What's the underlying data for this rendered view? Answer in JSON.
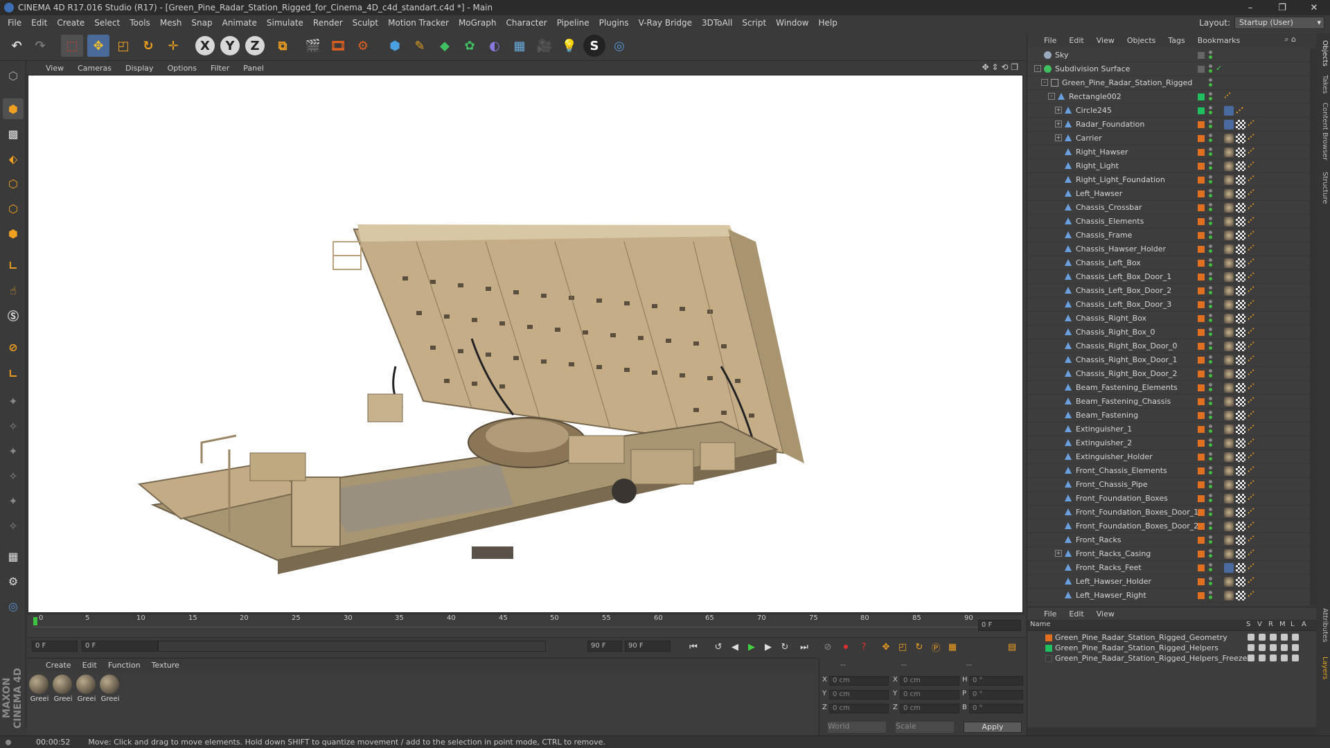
{
  "window": {
    "title": "CINEMA 4D R17.016 Studio (R17) - [Green_Pine_Radar_Station_Rigged_for_Cinema_4D_c4d_standart.c4d *] - Main",
    "controls": [
      "–",
      "❐",
      "✕"
    ]
  },
  "menu": [
    "File",
    "Edit",
    "Create",
    "Select",
    "Tools",
    "Mesh",
    "Snap",
    "Animate",
    "Simulate",
    "Render",
    "Sculpt",
    "Motion Tracker",
    "MoGraph",
    "Character",
    "Pipeline",
    "Plugins",
    "V-Ray Bridge",
    "3DToAll",
    "Script",
    "Window",
    "Help"
  ],
  "layout": {
    "label": "Layout:",
    "value": "Startup (User)"
  },
  "toolbar": {
    "axis_x": "X",
    "axis_y": "Y",
    "axis_z": "Z"
  },
  "viewport_menu": [
    "View",
    "Cameras",
    "Display",
    "Options",
    "Filter",
    "Panel"
  ],
  "timeline": {
    "ticks": [
      "0",
      "5",
      "10",
      "15",
      "20",
      "25",
      "30",
      "35",
      "40",
      "45",
      "50",
      "55",
      "60",
      "65",
      "70",
      "75",
      "80",
      "85",
      "90"
    ],
    "current_frame": "0 F"
  },
  "transport": {
    "start_field": "0 F",
    "range_start": "0 F",
    "range_end": "90 F",
    "end_field": "90 F"
  },
  "material_menu": [
    "Create",
    "Edit",
    "Function",
    "Texture"
  ],
  "materials": [
    "Greei",
    "Greei",
    "Greei",
    "Greei"
  ],
  "coordinates": {
    "header_dashes": [
      "--",
      "--",
      "--"
    ],
    "rows": [
      {
        "a1": "X",
        "v1": "0 cm",
        "a2": "X",
        "v2": "0 cm",
        "a3": "H",
        "v3": "0 °"
      },
      {
        "a1": "Y",
        "v1": "0 cm",
        "a2": "Y",
        "v2": "0 cm",
        "a3": "P",
        "v3": "0 °"
      },
      {
        "a1": "Z",
        "v1": "0 cm",
        "a2": "Z",
        "v2": "0 cm",
        "a3": "B",
        "v3": "0 °"
      }
    ],
    "mode": "World",
    "scale": "Scale",
    "apply": "Apply"
  },
  "status": {
    "time": "00:00:52",
    "message": "Move: Click and drag to move elements. Hold down SHIFT to quantize movement / add to the selection in point mode, CTRL to remove."
  },
  "maxon": "MAXON CINEMA 4D",
  "object_manager": {
    "menu": [
      "File",
      "Edit",
      "View",
      "Objects",
      "Tags",
      "Bookmarks"
    ],
    "objects": [
      {
        "name": "Sky"
      },
      {
        "name": "Subdivision Surface"
      },
      {
        "name": "Green_Pine_Radar_Station_Rigged"
      },
      {
        "name": "Rectangle002"
      },
      {
        "name": "Circle245"
      },
      {
        "name": "Radar_Foundation"
      },
      {
        "name": "Carrier"
      },
      {
        "name": "Right_Hawser"
      },
      {
        "name": "Right_Light"
      },
      {
        "name": "Right_Light_Foundation"
      },
      {
        "name": "Left_Hawser"
      },
      {
        "name": "Chassis_Crossbar"
      },
      {
        "name": "Chassis_Elements"
      },
      {
        "name": "Chassis_Frame"
      },
      {
        "name": "Chassis_Hawser_Holder"
      },
      {
        "name": "Chassis_Left_Box"
      },
      {
        "name": "Chassis_Left_Box_Door_1"
      },
      {
        "name": "Chassis_Left_Box_Door_2"
      },
      {
        "name": "Chassis_Left_Box_Door_3"
      },
      {
        "name": "Chassis_Right_Box"
      },
      {
        "name": "Chassis_Right_Box_0"
      },
      {
        "name": "Chassis_Right_Box_Door_0"
      },
      {
        "name": "Chassis_Right_Box_Door_1"
      },
      {
        "name": "Chassis_Right_Box_Door_2"
      },
      {
        "name": "Beam_Fastening_Elements"
      },
      {
        "name": "Beam_Fastening_Chassis"
      },
      {
        "name": "Beam_Fastening"
      },
      {
        "name": "Extinguisher_1"
      },
      {
        "name": "Extinguisher_2"
      },
      {
        "name": "Extinguisher_Holder"
      },
      {
        "name": "Front_Chassis_Elements"
      },
      {
        "name": "Front_Chassis_Pipe"
      },
      {
        "name": "Front_Foundation_Boxes"
      },
      {
        "name": "Front_Foundation_Boxes_Door_1"
      },
      {
        "name": "Front_Foundation_Boxes_Door_2"
      },
      {
        "name": "Front_Racks"
      },
      {
        "name": "Front_Racks_Casing"
      },
      {
        "name": "Front_Racks_Feet"
      },
      {
        "name": "Left_Hawser_Holder"
      },
      {
        "name": "Left_Hawser_Right"
      }
    ]
  },
  "side_tabs": [
    "Objects",
    "Takes",
    "Content Browser",
    "Structure",
    "Attributes",
    "Layers"
  ],
  "layer_manager": {
    "menu": [
      "File",
      "Edit",
      "View"
    ],
    "headers": [
      "Name",
      "S",
      "V",
      "R",
      "M",
      "L",
      "A"
    ],
    "layers": [
      {
        "name": "Green_Pine_Radar_Station_Rigged_Geometry",
        "color": "#e07020"
      },
      {
        "name": "Green_Pine_Radar_Station_Rigged_Helpers",
        "color": "#20c060"
      },
      {
        "name": "Green_Pine_Radar_Station_Rigged_Helpers_Freeze",
        "color": "#3a3a3a"
      }
    ]
  },
  "colors": {
    "orange_layer": "#e07020",
    "green_layer": "#20c060",
    "accent_blue": "#3d6fb5",
    "model_tan": "#c9b48f"
  }
}
